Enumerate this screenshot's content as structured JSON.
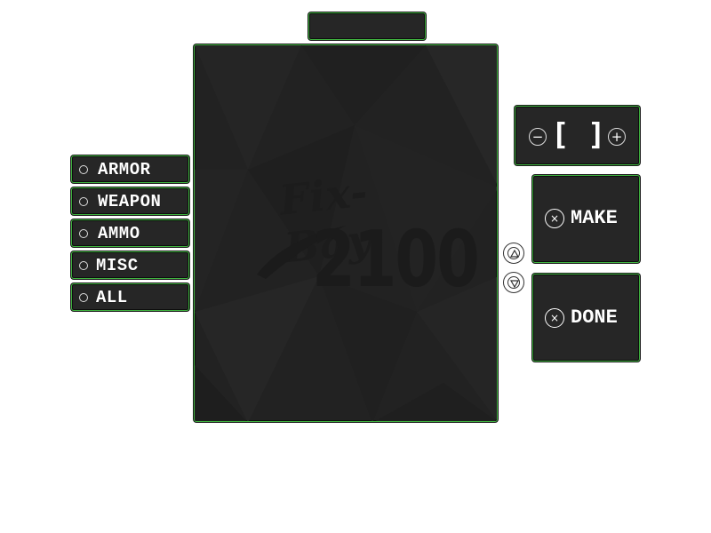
{
  "title_bar": {
    "text": ""
  },
  "main_panel": {
    "logo_top": "Fix-Bay",
    "logo_number": "2100"
  },
  "categories": [
    {
      "label": "ARMOR"
    },
    {
      "label": "WEAPON"
    },
    {
      "label": "AMMO"
    },
    {
      "label": "MISC"
    },
    {
      "label": "ALL"
    }
  ],
  "quantity": {
    "value": "",
    "minus_symbol": "−",
    "plus_symbol": "+",
    "left_bracket": "[",
    "right_bracket": "]"
  },
  "actions": {
    "make_label": "MAKE",
    "done_label": "DONE",
    "icon_symbol": "×"
  },
  "theme": {
    "panel_bg": "#262626",
    "border_accent": "#3fb33f",
    "text": "#ffffff"
  },
  "icons": {
    "scroll_up": "up-triangle-icon",
    "scroll_down": "down-triangle-icon",
    "category_radio": "radio-circle-icon"
  }
}
